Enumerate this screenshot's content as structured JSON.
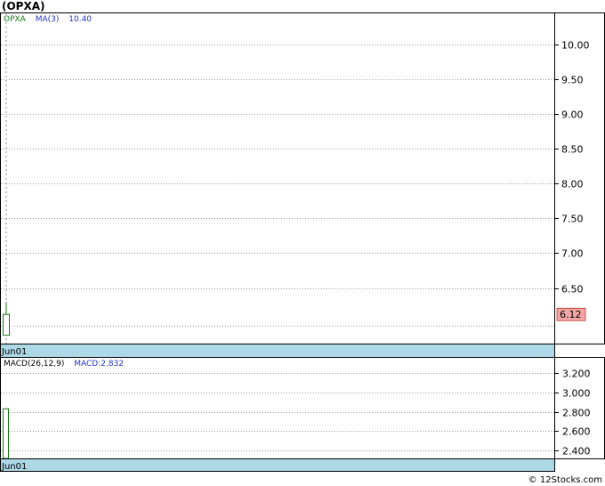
{
  "chart_data": [
    {
      "type": "candlestick",
      "title": "(OPXA)",
      "legend": [
        {
          "label": "OPXA",
          "color": "#1a7a1a"
        },
        {
          "label": "MA(3)",
          "color": "#2233cc"
        },
        {
          "label": "10.40",
          "color": "#2233cc"
        }
      ],
      "y_ticks": [
        "10.00",
        "9.50",
        "9.00",
        "8.50",
        "8.00",
        "7.50",
        "7.00",
        "6.50"
      ],
      "y_tick_values": [
        10.0,
        9.5,
        9.0,
        8.5,
        8.0,
        7.5,
        7.0,
        6.5
      ],
      "ylim": [
        5.7,
        10.45
      ],
      "x_labels": [
        "Jun01"
      ],
      "candles": [
        {
          "x": "Jun01",
          "open": 5.82,
          "high": 6.3,
          "low": 5.82,
          "close": 6.12
        }
      ],
      "last_price_label": "6.12",
      "grid": true
    },
    {
      "type": "bar",
      "legend": [
        {
          "label": "MACD(26,12,9)",
          "color": "#000000"
        },
        {
          "label": "MACD:2.832",
          "color": "#2233cc"
        }
      ],
      "y_ticks": [
        "3.200",
        "3.000",
        "2.800",
        "2.600",
        "2.400"
      ],
      "y_tick_values": [
        3.2,
        3.0,
        2.8,
        2.6,
        2.4
      ],
      "ylim": [
        2.318,
        3.36
      ],
      "x_labels": [
        "Jun01"
      ],
      "values": [
        2.832
      ],
      "grid": true
    }
  ],
  "credit": "© 12Stocks.com",
  "colors": {
    "axis_band": "#add8e6",
    "price_box_fill": "#f4a6a6",
    "candle_up": "#1a7a1a",
    "grid": "#999999"
  }
}
